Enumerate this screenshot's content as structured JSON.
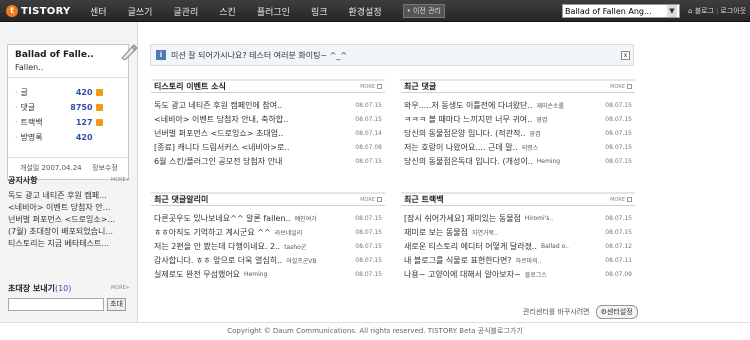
{
  "topbar": {
    "logo_mark": "t",
    "logo_text": "TISTORY",
    "menu": [
      "센터",
      "글쓰기",
      "글관리",
      "스킨",
      "플러그인",
      "링크",
      "환경설정"
    ],
    "prev_admin": "• 이전 관리",
    "blog_select": "Ballad of Fallen Ang...",
    "blog_home": "블로그",
    "logout": "로그아웃"
  },
  "profile": {
    "title": "Ballad of Falle..",
    "subtitle": "Fallen..",
    "stats": [
      {
        "label": "글",
        "value": "420"
      },
      {
        "label": "댓글",
        "value": "8750"
      },
      {
        "label": "트랙백",
        "value": "127"
      },
      {
        "label": "방명록",
        "value": "420"
      }
    ],
    "opened": "개설일 2007.04.24",
    "edit_info": "정보수정"
  },
  "notice_section": {
    "title": "공지사항",
    "more": "MORE+",
    "items": [
      "독도 광고 네티즌 후원 캠페...",
      "<네비아> 이벤트 당첨자 안...",
      "넌버벌 퍼포먼스 <드로잉소>...",
      "(7월) 초대장이 배포되었습니...",
      "티스토리는 지금 베타테스트..."
    ]
  },
  "invite": {
    "title": "초대장 보내기",
    "count": "(10)",
    "more": "MORE+",
    "button": "초대"
  },
  "notice_bar": {
    "icon": "i",
    "message": "미션 잘 되어가시나요? 테스터 여러분 화이팅~ ^_^",
    "close": "x"
  },
  "panels": {
    "events": {
      "title": "티스토리 이벤트 소식",
      "more": "MORE",
      "rows": [
        {
          "text": "독도 광고 네티즌 후원 캠페인에 참여..",
          "author": "",
          "date": "08.07.15"
        },
        {
          "text": "<네비아> 이벤트 당첨자 안내, 축하합..",
          "author": "",
          "date": "08.07.15"
        },
        {
          "text": "넌버벌 퍼포먼스 <드로잉쇼> 초대업..",
          "author": "",
          "date": "08.07.14"
        },
        {
          "text": "[종료] 캐니다 드림서커스 <네비아>로..",
          "author": "",
          "date": "08.07.08"
        },
        {
          "text": "6월 스킨/플러그인 공모전 당첨자 안내",
          "author": "",
          "date": "08.07.15"
        }
      ]
    },
    "comments": {
      "title": "최근 댓글",
      "more": "MORE",
      "rows": [
        {
          "text": "와우.....저 동생도 이틀전에 다녀왔단..",
          "author": "재미손소롤",
          "date": "08.07.15"
        },
        {
          "text": "ㅋㅋㅋ 볼 때마다 느끼지만 너무 귀여..",
          "author": "영겸",
          "date": "08.07.15"
        },
        {
          "text": "당신의 동물점은양 입니다. (적관적..",
          "author": "영겸",
          "date": "08.07.15"
        },
        {
          "text": "저는 호랑이 나왔어요.... 근데 말..",
          "author": "의령스",
          "date": "08.07.15"
        },
        {
          "text": "당신의 동물점은독대 입니다. (개성이..",
          "author": "Heming",
          "date": "08.07.15"
        }
      ]
    },
    "guestbook": {
      "title": "최근 댓글알리미",
      "more": "MORE",
      "rows": [
        {
          "text": "다른곳우도 있나보네요^^ 알론 fallen..",
          "author": "예인여가",
          "date": "08.07.15"
        },
        {
          "text": "ㅎㅎ아직도 기억하고 계시군요 ^^",
          "author": "라브네일리",
          "date": "08.07.15"
        },
        {
          "text": "저는 2편을 안 봤는데 다행이네요. 2..",
          "author": "tasho군",
          "date": "08.07.15"
        },
        {
          "text": "감사합니다. ㅎㅎ 앞으로 더욱 열심히..",
          "author": "어설프군VB",
          "date": "08.07.15"
        },
        {
          "text": "실제로도 완전 무섬했어요",
          "author": "Heming",
          "date": "08.07.15"
        }
      ]
    },
    "trackbacks": {
      "title": "최근 트랙백",
      "more": "MORE",
      "rows": [
        {
          "text": "[잠시 쉬어가세요] 재미있는 동물점",
          "author": "Hiromi's..",
          "date": "08.07.15"
        },
        {
          "text": "재미로 보는 동물점",
          "author": "자연거북..",
          "date": "08.07.15"
        },
        {
          "text": "새로운 티스토리 에디터 어떻게 달라졌..",
          "author": "Ballad o..",
          "date": "08.07.12"
        },
        {
          "text": "내 블로그를 식물로 표현한다면?",
          "author": "하르마의..",
          "date": "08.07.11"
        },
        {
          "text": "나용~ 고양이에 대해서 알아보자~",
          "author": "블로그스",
          "date": "08.07.09"
        }
      ]
    }
  },
  "admin": {
    "text": "관리센터를 바꾸시려면",
    "button": "⚙센터설정"
  },
  "footer": "Copyright © Daum Communications. All rights reserved. TISTORY Beta 공식블로그가기",
  "colors": {
    "topbar": "#2e2e2e",
    "accent": "#f07c1a",
    "link_value": "#2a52a8"
  }
}
